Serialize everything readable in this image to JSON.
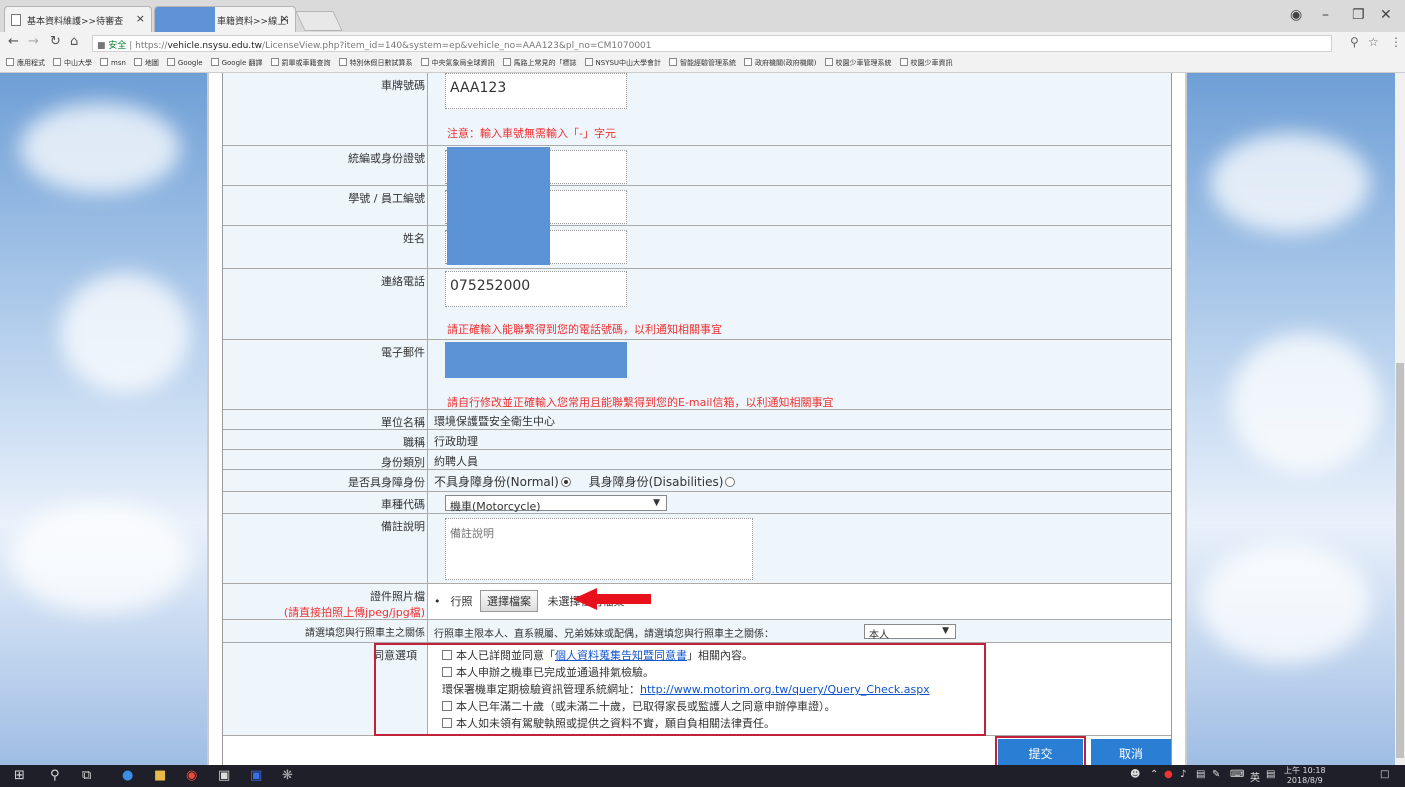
{
  "browser": {
    "tabs": [
      {
        "title": "基本資料維護>>待審查 ",
        "close": "×"
      },
      {
        "title": "車籍資料>>線上i",
        "close": "×"
      }
    ],
    "url_secure": "安全",
    "url_prefix": "https://",
    "url_domain": "vehicle.nsysu.edu.tw",
    "url_rest": "/LicenseView.php?item_id=140&system=ep&vehicle_no=AAA123&pl_no=CM1070001",
    "bookmarks": [
      "應用程式",
      "中山大學",
      "msn",
      "地圖",
      "Google",
      "Google 翻譯",
      "罰單或車籍查詢",
      "特別休假日數試算系",
      "中央氣象局全球資訊",
      "馬路上常見的「標誌",
      "NSYSU中山大學會計",
      "智能經驗管理系統",
      "政府機關(政府機關)",
      "校園少車管理系統",
      "校園少車資訊"
    ]
  },
  "form": {
    "plate": {
      "label": "車牌號碼",
      "value": "AAA123",
      "note": "注意：輸入車號無需輸入「-」字元"
    },
    "id_no": {
      "label": "統編或身份證號"
    },
    "staff_no": {
      "label": "學號 / 員工編號"
    },
    "name": {
      "label": "姓名"
    },
    "phone": {
      "label": "連絡電話",
      "value": "075252000",
      "note": "請正確輸入能聯繫得到您的電話號碼，以利通知相關事宜"
    },
    "email": {
      "label": "電子郵件",
      "note": "請自行修改並正確輸入您常用且能聯繫得到您的E-mail信箱，以利通知相關事宜"
    },
    "unit": {
      "label": "單位名稱",
      "value": "環境保護暨安全衛生中心"
    },
    "title": {
      "label": "職稱",
      "value": "行政助理"
    },
    "identity": {
      "label": "身份類別",
      "value": "約聘人員"
    },
    "disability": {
      "label": "是否具身障身份",
      "option1": "不具身障身份(Normal)",
      "option2": "具身障身份(Disabilities)",
      "selected": "option1"
    },
    "vehicle_type": {
      "label": "車種代碼",
      "value": "機車(Motorcycle)"
    },
    "remark": {
      "label": "備註說明",
      "placeholder": "備註說明"
    },
    "photo": {
      "label": "證件照片檔",
      "label2": "(請直接拍照上傳jpeg/jpg檔)",
      "bullet": "•",
      "item": "行照",
      "button": "選擇檔案",
      "status_text": "未選擇任何檔案"
    },
    "relation": {
      "label": "請選填您與行照車主之關係",
      "text": "行照車主限本人、直系親屬、兄弟姊妹或配偶，請選填您與行照車主之關係：",
      "value": "本人"
    },
    "consent": {
      "label": "同意選項",
      "line1_a": "本人已詳閱並同意「",
      "line1_link": "個人資料蒐集告知暨同意書",
      "line1_b": "」相關內容。",
      "line2": "本人申辦之機車已完成並通過排氣檢驗。",
      "line3_a": "環保署機車定期檢驗資訊管理系統網址：",
      "line3_link": "http://www.motorim.org.tw/query/Query_Check.aspx",
      "line4": "本人已年滿二十歲（或未滿二十歲，已取得家長或監護人之同意申辦停車證）。",
      "line5": "本人如未領有駕駛執照或提供之資料不實，願自負相關法律責任。"
    },
    "submit": "提交",
    "cancel": "取消"
  },
  "taskbar": {
    "time": "上午 10:18",
    "date": "2018/8/9",
    "lang": "英"
  },
  "colors": {
    "accent": "#2a7fd4",
    "note": "#e33333",
    "highlight": "#c0223a",
    "arrow": "#e8101a"
  }
}
